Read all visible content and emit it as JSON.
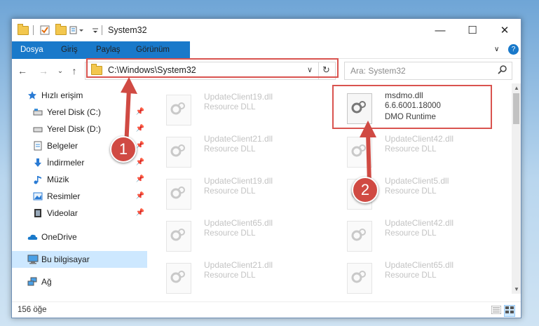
{
  "window": {
    "title": "System32",
    "controls": {
      "minimize": "—",
      "maximize": "☐",
      "close": "✕"
    }
  },
  "ribbon": {
    "tabs": [
      "Dosya",
      "Giriş",
      "Paylaş",
      "Görünüm"
    ],
    "collapse_icon": "chevron-down-icon",
    "help_icon": "?"
  },
  "addressbar": {
    "path": "C:\\Windows\\System32",
    "search_placeholder": "Ara: System32"
  },
  "sidebar": {
    "items": [
      {
        "label": "Hızlı erişim",
        "icon": "star-icon"
      },
      {
        "label": "Yerel Disk (C:)",
        "icon": "drive-icon"
      },
      {
        "label": "Yerel Disk (D:)",
        "icon": "drive-icon"
      },
      {
        "label": "Belgeler",
        "icon": "documents-icon"
      },
      {
        "label": "İndirmeler",
        "icon": "downloads-icon"
      },
      {
        "label": "Müzik",
        "icon": "music-icon"
      },
      {
        "label": "Resimler",
        "icon": "pictures-icon"
      },
      {
        "label": "Videolar",
        "icon": "videos-icon"
      },
      {
        "label": "OneDrive",
        "icon": "cloud-icon"
      },
      {
        "label": "Bu bilgisayar",
        "icon": "computer-icon"
      },
      {
        "label": "Ağ",
        "icon": "network-icon"
      }
    ]
  },
  "files": {
    "left": [
      {
        "name": "UpdateClient19.dll",
        "type": "Resource DLL"
      },
      {
        "name": "UpdateClient21.dll",
        "type": "Resource DLL"
      },
      {
        "name": "UpdateClient19.dll",
        "type": "Resource DLL"
      },
      {
        "name": "UpdateClient65.dll",
        "type": "Resource DLL"
      },
      {
        "name": "UpdateClient21.dll",
        "type": "Resource DLL"
      }
    ],
    "right": [
      {
        "name": "UpdateClient42.dll",
        "type": "Resource DLL"
      },
      {
        "name": "UpdateClient5.dll",
        "type": "Resource DLL"
      },
      {
        "name": "UpdateClient42.dll",
        "type": "Resource DLL"
      },
      {
        "name": "UpdateClient65.dll",
        "type": "Resource DLL"
      }
    ],
    "highlighted": {
      "name": "msdmo.dll",
      "version": "6.6.6001.18000",
      "description": "DMO Runtime"
    }
  },
  "annotations": {
    "badge1": "1",
    "badge2": "2"
  },
  "status": {
    "count": "156 öğe"
  },
  "colors": {
    "accent": "#1979ca",
    "highlight": "#d9534f",
    "selection": "#cde8ff"
  }
}
